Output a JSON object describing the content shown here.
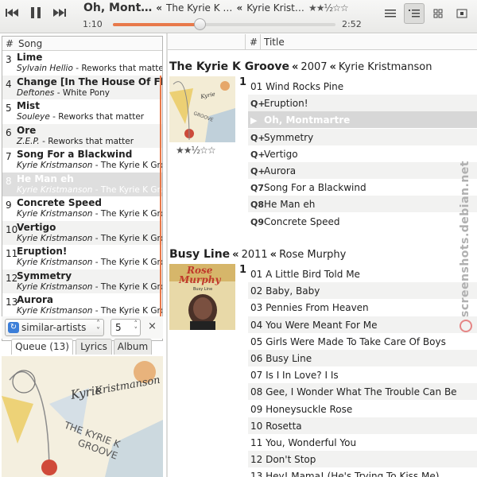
{
  "toolbar": {
    "now_title": "Oh, Mont…",
    "sep": "«",
    "now_album": "The Kyrie K …",
    "now_artist": "Kyrie Krist…",
    "stars": "★★½☆☆",
    "time_current": "1:10",
    "time_total": "2:52",
    "progress_fraction": 0.39
  },
  "queue": {
    "col_num": "#",
    "col_song": "Song",
    "rows": [
      {
        "num": "3",
        "title": "Lime",
        "artist": "Sylvain Hellio",
        "album": "Reworks that matter"
      },
      {
        "num": "4",
        "title": "Change [In The House Of Flies]",
        "artist": "Deftones",
        "album": "White Pony"
      },
      {
        "num": "5",
        "title": "Mist",
        "artist": "Souleye",
        "album": "Reworks that matter"
      },
      {
        "num": "6",
        "title": "Ore",
        "artist": "Z.E.P.",
        "album": "Reworks that matter"
      },
      {
        "num": "7",
        "title": "Song For a Blackwind",
        "artist": "Kyrie Kristmanson",
        "album": "The Kyrie K Groove"
      },
      {
        "num": "8",
        "title": "He Man eh",
        "artist": "Kyrie Kristmanson",
        "album": "The Kyrie K Groove"
      },
      {
        "num": "9",
        "title": "Concrete Speed",
        "artist": "Kyrie Kristmanson",
        "album": "The Kyrie K Groove"
      },
      {
        "num": "10",
        "title": "Vertigo",
        "artist": "Kyrie Kristmanson",
        "album": "The Kyrie K Groove"
      },
      {
        "num": "11",
        "title": "Eruption!",
        "artist": "Kyrie Kristmanson",
        "album": "The Kyrie K Groove"
      },
      {
        "num": "12",
        "title": "Symmetry",
        "artist": "Kyrie Kristmanson",
        "album": "The Kyrie K Groove"
      },
      {
        "num": "13",
        "title": "Aurora",
        "artist": "Kyrie Kristmanson",
        "album": "The Kyrie K Groove"
      }
    ],
    "mode_value": "similar-artists",
    "count_value": "5",
    "close_label": "×"
  },
  "tabs": [
    "Queue (13)",
    "Lyrics",
    "Album"
  ],
  "library": {
    "col_num": "#",
    "col_title": "Title",
    "albums": [
      {
        "title": "The Kyrie K Groove",
        "year": "2007",
        "artist": "Kyrie Kristmanson",
        "disc": "1",
        "stars": "★★½☆☆",
        "tracks": [
          {
            "icon": "",
            "text": "01 Wind Rocks Pine"
          },
          {
            "icon": "Q+",
            "text": "Eruption!"
          },
          {
            "icon": "▶",
            "text": "Oh, Montmartre"
          },
          {
            "icon": "Q+",
            "text": "Symmetry"
          },
          {
            "icon": "Q+",
            "text": "Vertigo"
          },
          {
            "icon": "Q+",
            "text": "Aurora"
          },
          {
            "icon": "Q7",
            "text": "Song For a Blackwind"
          },
          {
            "icon": "Q8",
            "text": "He Man eh"
          },
          {
            "icon": "Q9",
            "text": "Concrete Speed"
          }
        ]
      },
      {
        "title": "Busy Line",
        "year": "2011",
        "artist": "Rose Murphy",
        "disc": "1",
        "tracks": [
          {
            "icon": "",
            "text": "01 A Little Bird Told Me"
          },
          {
            "icon": "",
            "text": "02 Baby, Baby"
          },
          {
            "icon": "",
            "text": "03 Pennies From Heaven"
          },
          {
            "icon": "",
            "text": "04 You Were Meant For Me"
          },
          {
            "icon": "",
            "text": "05 Girls Were Made To Take Care Of Boys"
          },
          {
            "icon": "",
            "text": "06 Busy Line"
          },
          {
            "icon": "",
            "text": "07 Is I In Love? I Is"
          },
          {
            "icon": "",
            "text": "08 Gee, I Wonder What The Trouble Can Be"
          },
          {
            "icon": "",
            "text": "09 Honeysuckle Rose"
          },
          {
            "icon": "",
            "text": "10 Rosetta"
          },
          {
            "icon": "",
            "text": "11 You, Wonderful You"
          },
          {
            "icon": "",
            "text": "12 Don't Stop"
          },
          {
            "icon": "",
            "text": "13 Hey! Mama! (He's Trying To Kiss Me)"
          }
        ]
      }
    ]
  },
  "cover_kk": {
    "line1": "Kyrie",
    "line2": "Kristmanson",
    "line3": "THE KYRIE K",
    "line4": "GROOVE"
  },
  "cover_rm": {
    "line1": "Rose",
    "line2": "Murphy",
    "line3": "Busy Line"
  },
  "watermark": "screenshots.debian.net",
  "colors": {
    "accent": "#e8794a",
    "selection": "#d7d7d7",
    "alt_row": "#f2f2f1"
  }
}
